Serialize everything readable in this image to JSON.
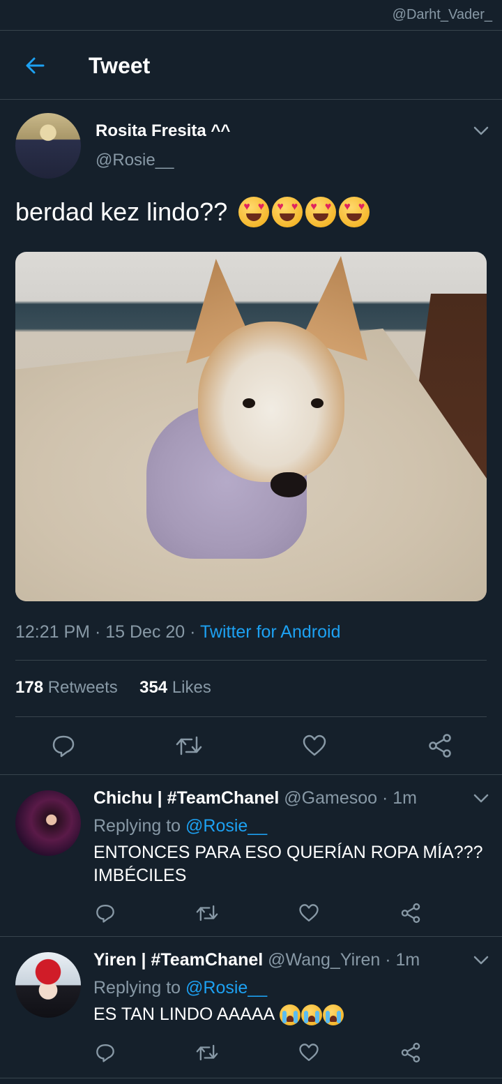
{
  "watermark": "@Darht_Vader_",
  "header": {
    "title": "Tweet"
  },
  "tweet": {
    "author_name": "Rosita Fresita ^^",
    "author_handle": "@Rosie__",
    "text": "berdad kez lindo??",
    "emojis": [
      "heart-eyes-emoji",
      "heart-eyes-emoji",
      "heart-eyes-emoji",
      "heart-eyes-emoji"
    ],
    "time": "12:21 PM",
    "date": "15 Dec 20",
    "source": "Twitter for Android",
    "retweets_count": "178",
    "retweets_label": "Retweets",
    "likes_count": "354",
    "likes_label": "Likes"
  },
  "replies": [
    {
      "name": "Chichu | #TeamChanel",
      "handle": "@Gamesoo",
      "time": "1m",
      "replying_label": "Replying to",
      "replying_handle": "@Rosie__",
      "text_line1": "ENTONCES PARA ESO QUERÍAN ROPA MÍA???",
      "text_line2": "IMBÉCILES"
    },
    {
      "name": "Yiren | #TeamChanel",
      "handle": "@Wang_Yiren",
      "time": "1m",
      "replying_label": "Replying to",
      "replying_handle": "@Rosie__",
      "text": "ES TAN LINDO AAAAA",
      "emojis": [
        "crying-emoji",
        "crying-emoji",
        "crying-emoji"
      ]
    }
  ],
  "colors": {
    "background": "#15202b",
    "accent": "#1da1f2",
    "secondary_text": "#8899a6",
    "divider": "#38444d"
  },
  "icons": [
    "back-arrow-icon",
    "chevron-down-icon",
    "reply-icon",
    "retweet-icon",
    "like-icon",
    "share-icon"
  ]
}
